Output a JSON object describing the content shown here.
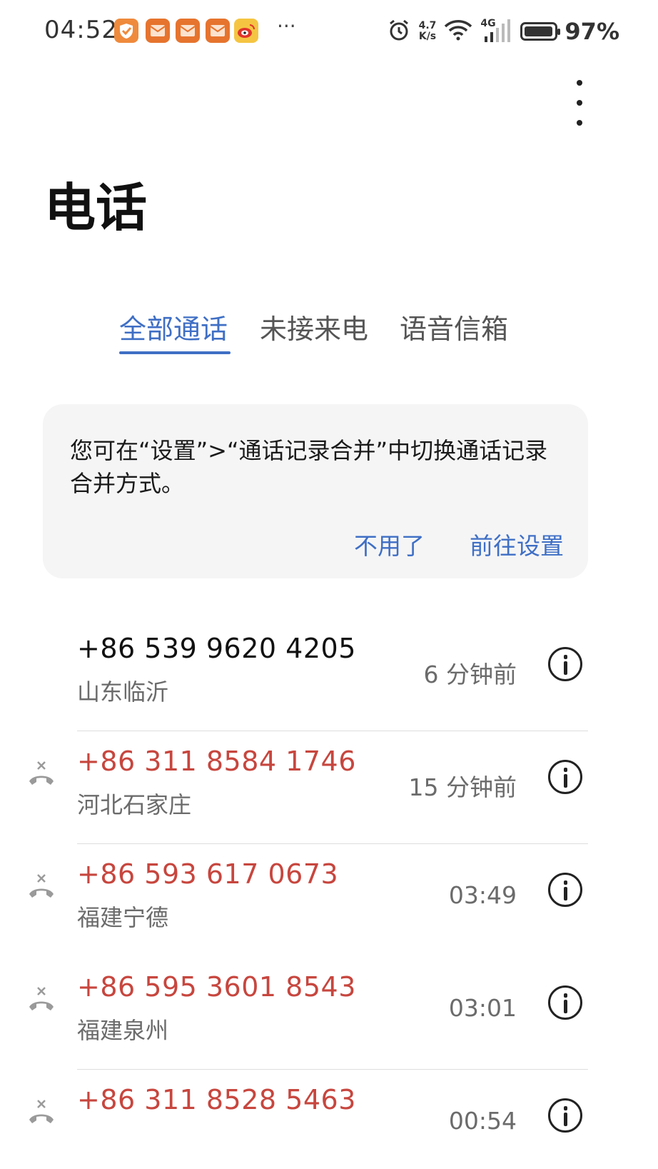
{
  "status_bar": {
    "time": "04:52",
    "overflow_indicator": "···",
    "net_speed_value": "4.7",
    "net_speed_unit": "K/s",
    "network_type": "4G",
    "battery_percent": "97%",
    "battery_level": 0.97,
    "app_notification_icons": [
      "orange-shield-app-icon",
      "orange-envelope-app-icon",
      "orange-envelope-app-icon",
      "orange-envelope-app-icon",
      "weibo-icon"
    ],
    "icons": [
      "alarm-icon",
      "wifi-icon",
      "signal-icon",
      "battery-icon"
    ]
  },
  "header": {
    "title": "电话",
    "menu_icon": "more-vertical-icon"
  },
  "tabs": [
    {
      "label": "全部通话",
      "active": true
    },
    {
      "label": "未接来电",
      "active": false
    },
    {
      "label": "语音信箱",
      "active": false
    }
  ],
  "tip_card": {
    "message": "您可在“设置”>“通话记录合并”中切换通话记录合并方式。",
    "dismiss_label": "不用了",
    "goto_settings_label": "前往设置"
  },
  "calls": [
    {
      "number": "+86 539 9620 4205",
      "location": "山东临沂",
      "time": "6 分钟前",
      "missed": false
    },
    {
      "number": "+86 311 8584 1746",
      "location": "河北石家庄",
      "time": "15 分钟前",
      "missed": true
    },
    {
      "number": "+86 593 617 0673",
      "location": "福建宁德",
      "time": "03:49",
      "missed": true
    },
    {
      "number": "+86 595 3601 8543",
      "location": "福建泉州",
      "time": "03:01",
      "missed": true
    },
    {
      "number": "+86 311 8528 5463",
      "location": "",
      "time": "00:54",
      "missed": true
    }
  ],
  "colors": {
    "accent": "#3f6fc5",
    "missed_call": "#c7463e",
    "secondary_text": "#6b6b6b",
    "card_background": "#f5f5f6"
  }
}
